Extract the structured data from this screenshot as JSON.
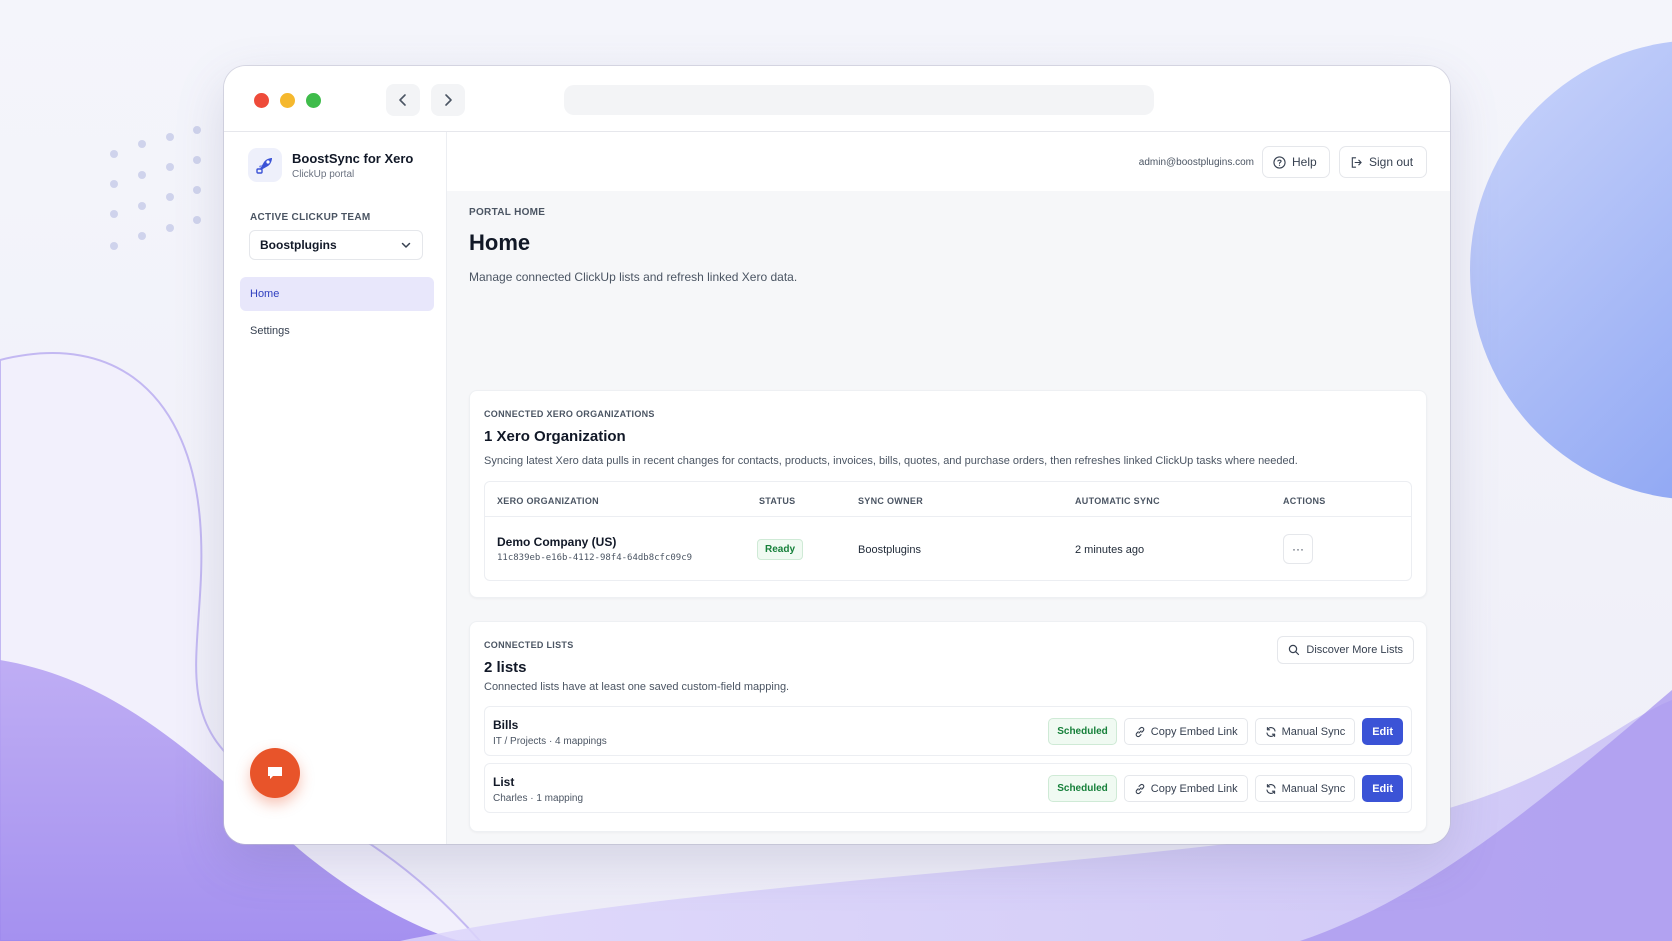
{
  "colors": {
    "accent": "#3b53d6",
    "active_nav_bg": "#e8e7fb",
    "status_green": "#16803a",
    "fab": "#e8542a",
    "traffic_red": "#ee4b3a",
    "traffic_yellow": "#f5b82e",
    "traffic_green": "#3fbc4b"
  },
  "browser": {
    "back_icon": "chevron-left-icon",
    "forward_icon": "chevron-right-icon"
  },
  "sidebar": {
    "brand_name": "BoostSync for Xero",
    "brand_sub": "ClickUp portal",
    "team_label": "ACTIVE CLICKUP TEAM",
    "team_value": "Boostplugins",
    "items": [
      {
        "label": "Home",
        "active": true
      },
      {
        "label": "Settings",
        "active": false
      }
    ]
  },
  "topbar": {
    "email": "admin@boostplugins.com",
    "help_label": "Help",
    "signout_label": "Sign out"
  },
  "page": {
    "kicker": "PORTAL HOME",
    "title": "Home",
    "description": "Manage connected ClickUp lists and refresh linked Xero data."
  },
  "orgs": {
    "kicker": "CONNECTED XERO ORGANIZATIONS",
    "title": "1 Xero Organization",
    "description": "Syncing latest Xero data pulls in recent changes for contacts, products, invoices, bills, quotes, and purchase orders, then refreshes linked ClickUp tasks where needed.",
    "columns": [
      "XERO ORGANIZATION",
      "STATUS",
      "SYNC OWNER",
      "AUTOMATIC SYNC",
      "ACTIONS"
    ],
    "rows": [
      {
        "name": "Demo Company (US)",
        "id": "11c839eb-e16b-4112-98f4-64db8cfc09c9",
        "status": "Ready",
        "owner": "Boostplugins",
        "auto_sync": "2 minutes ago",
        "actions": "···"
      }
    ]
  },
  "lists": {
    "kicker": "CONNECTED LISTS",
    "title": "2 lists",
    "description": "Connected lists have at least one saved custom-field mapping.",
    "discover_label": "Discover More Lists",
    "rows": [
      {
        "name": "Bills",
        "meta": "IT / Projects · 4 mappings",
        "status": "Scheduled",
        "copy": "Copy Embed Link",
        "sync": "Manual Sync",
        "edit": "Edit"
      },
      {
        "name": "List",
        "meta": "Charles · 1 mapping",
        "status": "Scheduled",
        "copy": "Copy Embed Link",
        "sync": "Manual Sync",
        "edit": "Edit"
      }
    ]
  }
}
